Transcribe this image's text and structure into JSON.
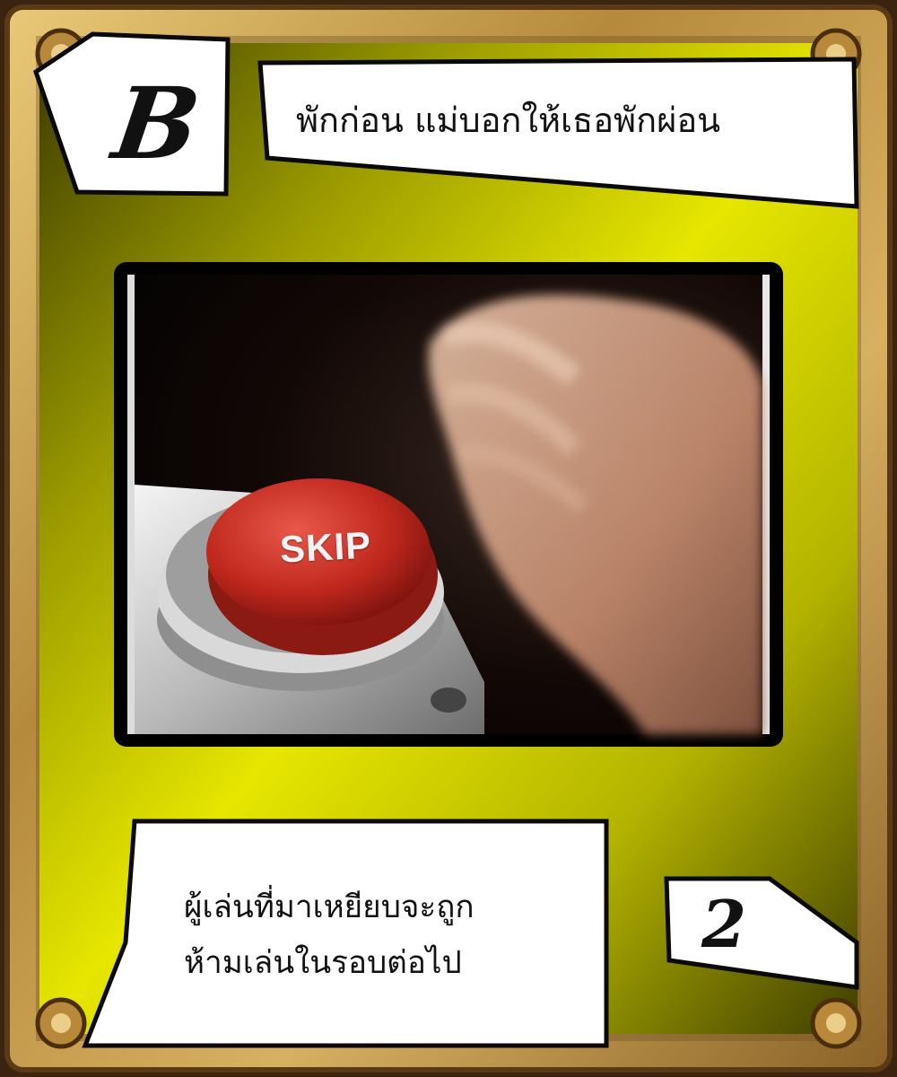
{
  "card": {
    "corner_letter": "B",
    "title": "พักก่อน แม่บอกให้เธอพักผ่อน",
    "rule_lines": [
      "ผู้เล่นที่มาเหยียบจะถูก",
      "ห้ามเล่นในรอบต่อไป"
    ],
    "number": "2",
    "illustration": {
      "button_label": "SKIP",
      "icons": [
        "red-skip-button-icon",
        "hand-icon"
      ]
    },
    "colors": {
      "frame_gold": "#c9a04a",
      "background_yellow": "#e6e600",
      "background_olive": "#4a4a00",
      "panel_white": "#ffffff",
      "button_red": "#c0281e"
    }
  }
}
